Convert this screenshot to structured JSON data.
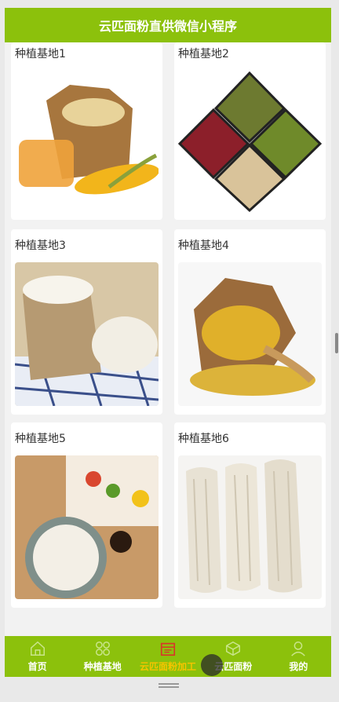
{
  "header": {
    "title": "云匹面粉直供微信小程序"
  },
  "cards": [
    {
      "label": "种植基地1"
    },
    {
      "label": "种植基地2"
    },
    {
      "label": "种植基地3"
    },
    {
      "label": "种植基地4"
    },
    {
      "label": "种植基地5"
    },
    {
      "label": "种植基地6"
    }
  ],
  "tabbar": {
    "items": [
      {
        "label": "首页",
        "icon": "home-icon"
      },
      {
        "label": "种植基地",
        "icon": "grid-flower-icon"
      },
      {
        "label": "云匹面粉加工",
        "icon": "calendar-icon"
      },
      {
        "label": "云匹面粉",
        "icon": "box-icon"
      },
      {
        "label": "我的",
        "icon": "user-icon"
      }
    ],
    "active_color": "#f6c400"
  },
  "colors": {
    "brand": "#8cc10c"
  }
}
